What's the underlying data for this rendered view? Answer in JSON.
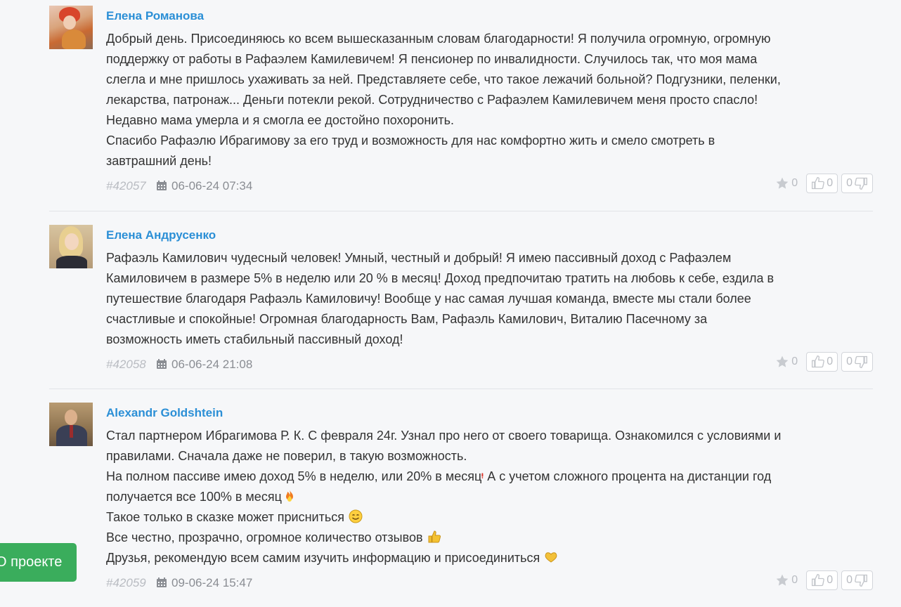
{
  "comments": [
    {
      "author": "Елена Романова",
      "id": "#42057",
      "date": "06-06-24 07:34",
      "text": "Добрый день. Присоединяюсь ко всем вышесказанным словам благодарности! Я получила огромную, огромную\nподдержку от работы в Рафаэлем Камилевичем! Я пенсионер по инвалидности. Случилось так, что моя мама\nслегла и мне пришлось ухаживать за ней. Представляете себе, что такое лежачий больной? Подгузники, пеленки,\nлекарства, патронаж... Деньги потекли рекой. Сотрудничество с Рафаэлем Камилевичем меня просто спасло!\nНедавно мама умерла и я смогла ее достойно похоронить.\nСпасибо Рафаэлю Ибрагимову за его труд и возможность для нас комфортно жить и смело смотреть в\nзавтрашний день!",
      "stars": "0",
      "likes": "0",
      "dislikes": "0"
    },
    {
      "author": "Елена Андрусенко",
      "id": "#42058",
      "date": "06-06-24 21:08",
      "text": "Рафаэль Камилович чудесный человек! Умный, честный и добрый! Я имею пассивный доход с Рафаэлем\nКамиловичем в размере 5% в неделю или 20 % в месяц! Доход предпочитаю тратить на любовь к себе, ездила в\nпутешествие благодаря Рафаэль Камиловичу! Вообще у нас самая лучшая команда, вместе мы стали более\nсчастливые и спокойные! Огромная благодарность Вам, Рафаэль Камилович, Виталию Пасечному за\nвозможность иметь стабильный пассивный доход!",
      "stars": "0",
      "likes": "0",
      "dislikes": "0"
    },
    {
      "author": "Alexandr Goldshtein",
      "id": "#42059",
      "date": "09-06-24 15:47",
      "lines": [
        "Стал партнером Ибрагимова Р. К. С февраля 24г. Узнал про него от своего товарища. Ознакомился с условиями и",
        "правилами. Сначала даже не поверил, в такую возможность.",
        "На полном пассиве имею доход 5% в неделю, или 20% в месяц",
        "А с учетом сложного процента на дистанции год",
        "получается все 100% в месяц",
        "Такое только в сказке может присниться",
        "Все честно, прозрачно, огромное количество отзывов",
        "Друзья, рекомендую всем самим изучить информацию и присоединиться"
      ],
      "stars": "0",
      "likes": "0",
      "dislikes": "0"
    }
  ],
  "project_button": "О проекте",
  "colors": {
    "author": "#2b8fd6",
    "button": "#3aad5c",
    "background": "#f6f7f9"
  },
  "icons": [
    "calendar-icon",
    "star-icon",
    "thumbs-up-icon",
    "thumbs-down-icon",
    "exclamation-emoji",
    "fire-emoji",
    "smile-emoji",
    "thumbs-up-emoji",
    "heart-hands-emoji"
  ]
}
